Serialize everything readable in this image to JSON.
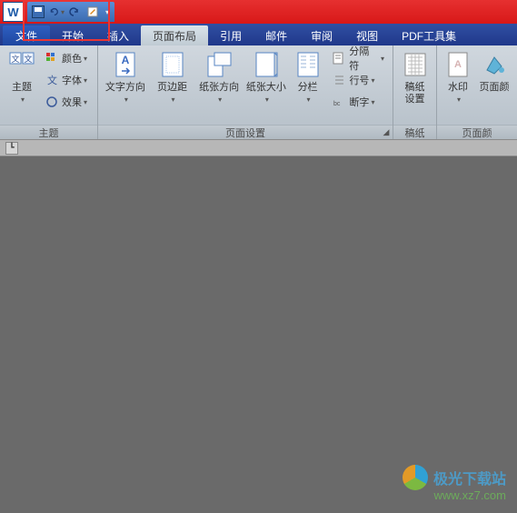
{
  "qat": {
    "save": "保存",
    "undo": "撤销",
    "redo": "重做",
    "edit": "编辑"
  },
  "tabs": {
    "file": "文件",
    "home": "开始",
    "insert": "插入",
    "layout": "页面布局",
    "references": "引用",
    "mailings": "邮件",
    "review": "审阅",
    "view": "视图",
    "pdftools": "PDF工具集"
  },
  "groups": {
    "theme": {
      "label": "主题",
      "theme_btn": "主题",
      "colors": "颜色",
      "fonts": "字体",
      "effects": "效果"
    },
    "page_setup": {
      "label": "页面设置",
      "direction": "文字方向",
      "margins": "页边距",
      "orientation": "纸张方向",
      "size": "纸张大小",
      "columns": "分栏",
      "breaks": "分隔符",
      "line_numbers": "行号",
      "hyphenation": "断字"
    },
    "manuscript": {
      "label": "稿纸",
      "settings": "稿纸\n设置"
    },
    "watermark": {
      "label": "页面颜",
      "watermark_btn": "水印",
      "page_color": "页面颜"
    }
  },
  "watermark_brand": {
    "title": "极光下载站",
    "url": "www.xz7.com"
  }
}
